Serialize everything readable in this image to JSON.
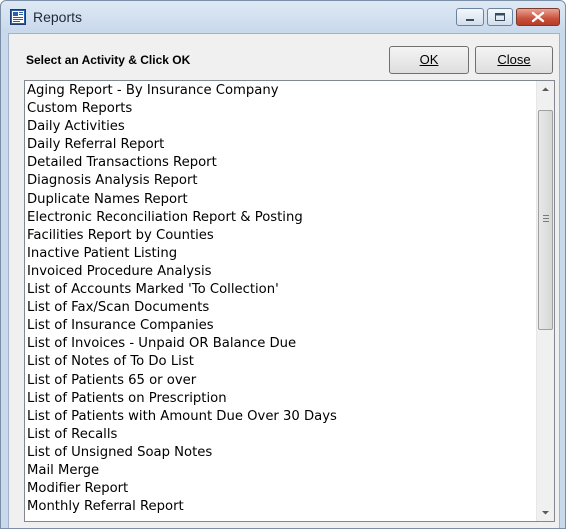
{
  "window": {
    "title": "Reports"
  },
  "dialog": {
    "prompt": "Select an Activity & Click OK",
    "ok_label": "OK",
    "close_label": "Close"
  },
  "reports_list": {
    "items": [
      "Aging Report - By Insurance Company",
      "Custom Reports",
      "Daily Activities",
      "Daily Referral Report",
      "Detailed Transactions Report",
      "Diagnosis Analysis Report",
      "Duplicate Names Report",
      "Electronic Reconciliation Report & Posting",
      "Facilities Report by Counties",
      "Inactive Patient Listing",
      "Invoiced Procedure Analysis",
      "List of Accounts Marked 'To Collection'",
      "List of Fax/Scan Documents",
      "List of Insurance Companies",
      "List of Invoices - Unpaid OR Balance Due",
      "List of Notes of To Do List",
      "List of Patients 65 or over",
      "List of Patients on Prescription",
      "List of Patients with Amount Due Over 30 Days",
      "List of Recalls",
      "List of Unsigned Soap Notes",
      "Mail Merge",
      "Modifier Report",
      "Monthly Referral Report"
    ]
  },
  "colors": {
    "titlebar": "#c9d9ec",
    "close_button": "#c8513b",
    "client_background": "#f0f0f0"
  },
  "icons": {
    "app": "reports-app-icon",
    "minimize": "minimize-icon",
    "maximize": "maximize-icon",
    "close": "close-icon",
    "scroll_up": "chevron-up-icon",
    "scroll_down": "chevron-down-icon"
  }
}
